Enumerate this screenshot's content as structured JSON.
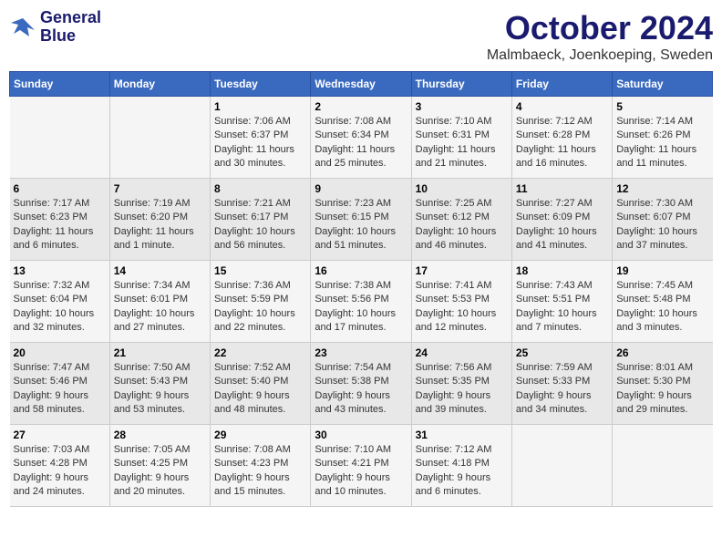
{
  "logo": {
    "line1": "General",
    "line2": "Blue"
  },
  "title": "October 2024",
  "location": "Malmbaeck, Joenkoeping, Sweden",
  "days_of_week": [
    "Sunday",
    "Monday",
    "Tuesday",
    "Wednesday",
    "Thursday",
    "Friday",
    "Saturday"
  ],
  "weeks": [
    [
      {
        "day": "",
        "info": ""
      },
      {
        "day": "",
        "info": ""
      },
      {
        "day": "1",
        "info": "Sunrise: 7:06 AM\nSunset: 6:37 PM\nDaylight: 11 hours\nand 30 minutes."
      },
      {
        "day": "2",
        "info": "Sunrise: 7:08 AM\nSunset: 6:34 PM\nDaylight: 11 hours\nand 25 minutes."
      },
      {
        "day": "3",
        "info": "Sunrise: 7:10 AM\nSunset: 6:31 PM\nDaylight: 11 hours\nand 21 minutes."
      },
      {
        "day": "4",
        "info": "Sunrise: 7:12 AM\nSunset: 6:28 PM\nDaylight: 11 hours\nand 16 minutes."
      },
      {
        "day": "5",
        "info": "Sunrise: 7:14 AM\nSunset: 6:26 PM\nDaylight: 11 hours\nand 11 minutes."
      }
    ],
    [
      {
        "day": "6",
        "info": "Sunrise: 7:17 AM\nSunset: 6:23 PM\nDaylight: 11 hours\nand 6 minutes."
      },
      {
        "day": "7",
        "info": "Sunrise: 7:19 AM\nSunset: 6:20 PM\nDaylight: 11 hours\nand 1 minute."
      },
      {
        "day": "8",
        "info": "Sunrise: 7:21 AM\nSunset: 6:17 PM\nDaylight: 10 hours\nand 56 minutes."
      },
      {
        "day": "9",
        "info": "Sunrise: 7:23 AM\nSunset: 6:15 PM\nDaylight: 10 hours\nand 51 minutes."
      },
      {
        "day": "10",
        "info": "Sunrise: 7:25 AM\nSunset: 6:12 PM\nDaylight: 10 hours\nand 46 minutes."
      },
      {
        "day": "11",
        "info": "Sunrise: 7:27 AM\nSunset: 6:09 PM\nDaylight: 10 hours\nand 41 minutes."
      },
      {
        "day": "12",
        "info": "Sunrise: 7:30 AM\nSunset: 6:07 PM\nDaylight: 10 hours\nand 37 minutes."
      }
    ],
    [
      {
        "day": "13",
        "info": "Sunrise: 7:32 AM\nSunset: 6:04 PM\nDaylight: 10 hours\nand 32 minutes."
      },
      {
        "day": "14",
        "info": "Sunrise: 7:34 AM\nSunset: 6:01 PM\nDaylight: 10 hours\nand 27 minutes."
      },
      {
        "day": "15",
        "info": "Sunrise: 7:36 AM\nSunset: 5:59 PM\nDaylight: 10 hours\nand 22 minutes."
      },
      {
        "day": "16",
        "info": "Sunrise: 7:38 AM\nSunset: 5:56 PM\nDaylight: 10 hours\nand 17 minutes."
      },
      {
        "day": "17",
        "info": "Sunrise: 7:41 AM\nSunset: 5:53 PM\nDaylight: 10 hours\nand 12 minutes."
      },
      {
        "day": "18",
        "info": "Sunrise: 7:43 AM\nSunset: 5:51 PM\nDaylight: 10 hours\nand 7 minutes."
      },
      {
        "day": "19",
        "info": "Sunrise: 7:45 AM\nSunset: 5:48 PM\nDaylight: 10 hours\nand 3 minutes."
      }
    ],
    [
      {
        "day": "20",
        "info": "Sunrise: 7:47 AM\nSunset: 5:46 PM\nDaylight: 9 hours\nand 58 minutes."
      },
      {
        "day": "21",
        "info": "Sunrise: 7:50 AM\nSunset: 5:43 PM\nDaylight: 9 hours\nand 53 minutes."
      },
      {
        "day": "22",
        "info": "Sunrise: 7:52 AM\nSunset: 5:40 PM\nDaylight: 9 hours\nand 48 minutes."
      },
      {
        "day": "23",
        "info": "Sunrise: 7:54 AM\nSunset: 5:38 PM\nDaylight: 9 hours\nand 43 minutes."
      },
      {
        "day": "24",
        "info": "Sunrise: 7:56 AM\nSunset: 5:35 PM\nDaylight: 9 hours\nand 39 minutes."
      },
      {
        "day": "25",
        "info": "Sunrise: 7:59 AM\nSunset: 5:33 PM\nDaylight: 9 hours\nand 34 minutes."
      },
      {
        "day": "26",
        "info": "Sunrise: 8:01 AM\nSunset: 5:30 PM\nDaylight: 9 hours\nand 29 minutes."
      }
    ],
    [
      {
        "day": "27",
        "info": "Sunrise: 7:03 AM\nSunset: 4:28 PM\nDaylight: 9 hours\nand 24 minutes."
      },
      {
        "day": "28",
        "info": "Sunrise: 7:05 AM\nSunset: 4:25 PM\nDaylight: 9 hours\nand 20 minutes."
      },
      {
        "day": "29",
        "info": "Sunrise: 7:08 AM\nSunset: 4:23 PM\nDaylight: 9 hours\nand 15 minutes."
      },
      {
        "day": "30",
        "info": "Sunrise: 7:10 AM\nSunset: 4:21 PM\nDaylight: 9 hours\nand 10 minutes."
      },
      {
        "day": "31",
        "info": "Sunrise: 7:12 AM\nSunset: 4:18 PM\nDaylight: 9 hours\nand 6 minutes."
      },
      {
        "day": "",
        "info": ""
      },
      {
        "day": "",
        "info": ""
      }
    ]
  ]
}
